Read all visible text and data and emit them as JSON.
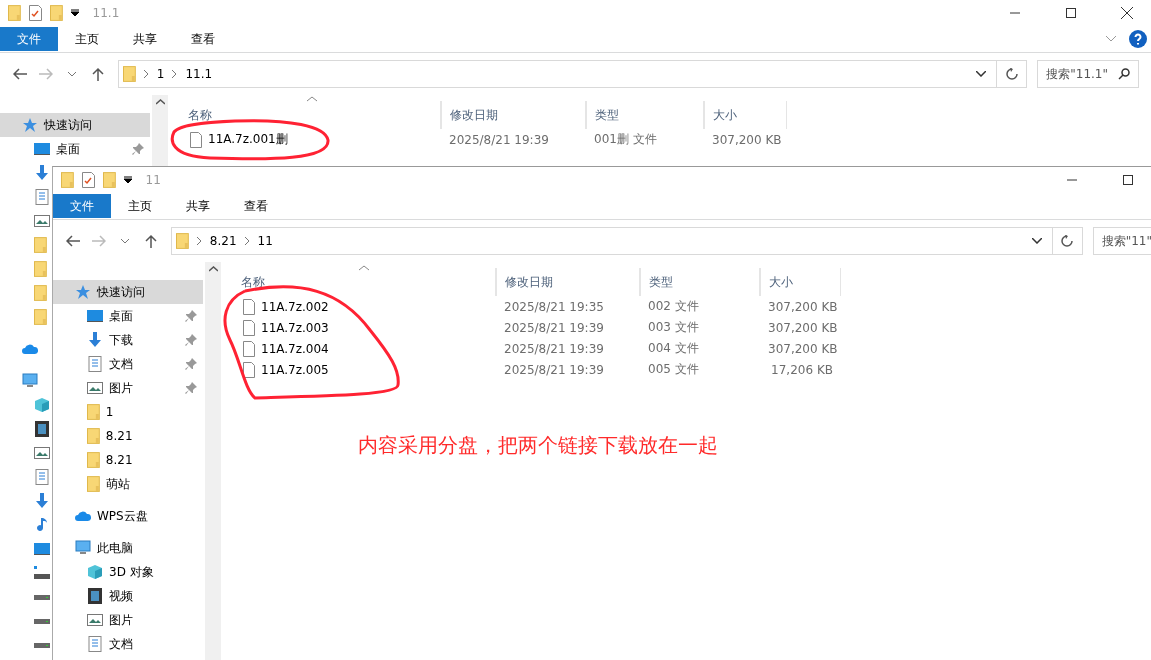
{
  "windows": [
    {
      "title": "11.1",
      "controls": [
        {
          "kind": "minimize"
        },
        {
          "kind": "maximize"
        },
        {
          "kind": "close"
        }
      ],
      "help": true,
      "ribbon_tabs": [
        {
          "label": "文件",
          "selected": true
        },
        {
          "label": "主页",
          "selected": false
        },
        {
          "label": "共享",
          "selected": false
        },
        {
          "label": "查看",
          "selected": false
        }
      ],
      "path": [
        "1",
        "11.1"
      ],
      "search": {
        "placeholder": "搜索\"11.1\""
      },
      "sidebar": [
        {
          "kind": "star",
          "label": "快速访问",
          "selected": true,
          "children": [
            {
              "kind": "desktop",
              "label": "桌面",
              "pinned": true
            },
            {
              "kind": "download"
            },
            {
              "kind": "doc"
            },
            {
              "kind": "picture"
            },
            {
              "kind": "folder"
            },
            {
              "kind": "folder"
            },
            {
              "kind": "folder"
            },
            {
              "kind": "folder"
            }
          ]
        },
        {
          "kind": "cloud"
        },
        {
          "kind": "pc",
          "children": [
            {
              "kind": "cube"
            },
            {
              "kind": "video"
            },
            {
              "kind": "picture"
            },
            {
              "kind": "doc"
            },
            {
              "kind": "download"
            },
            {
              "kind": "music"
            },
            {
              "kind": "desktop"
            },
            {
              "kind": "netdrive"
            },
            {
              "kind": "drive"
            },
            {
              "kind": "drive"
            },
            {
              "kind": "drive"
            }
          ]
        }
      ],
      "columns": [
        "名称",
        "修改日期",
        "类型",
        "大小"
      ],
      "files": [
        {
          "name": "11A.7z.001删",
          "date": "2025/8/21 19:39",
          "type": "001删 文件",
          "size": "307,200 KB"
        }
      ]
    },
    {
      "title": "11",
      "controls": [
        {
          "kind": "minimize"
        },
        {
          "kind": "maximize"
        }
      ],
      "help": false,
      "ribbon_tabs": [
        {
          "label": "文件",
          "selected": true
        },
        {
          "label": "主页",
          "selected": false
        },
        {
          "label": "共享",
          "selected": false
        },
        {
          "label": "查看",
          "selected": false
        }
      ],
      "path": [
        "8.21",
        "11"
      ],
      "search": {
        "placeholder": "搜索\"11\""
      },
      "sidebar": [
        {
          "kind": "star",
          "label": "快速访问",
          "selected": true,
          "children": [
            {
              "kind": "desktop",
              "label": "桌面",
              "pinned": true
            },
            {
              "kind": "download",
              "label": "下载",
              "pinned": true
            },
            {
              "kind": "doc",
              "label": "文档",
              "pinned": true
            },
            {
              "kind": "picture",
              "label": "图片",
              "pinned": true
            },
            {
              "kind": "folder",
              "label": "1",
              "pinned": false
            },
            {
              "kind": "folder",
              "label": "8.21",
              "pinned": false
            },
            {
              "kind": "folder",
              "label": "8.21",
              "pinned": false
            },
            {
              "kind": "folder",
              "label": "萌站",
              "pinned": false
            }
          ]
        },
        {
          "kind": "cloud",
          "label": "WPS云盘"
        },
        {
          "kind": "pc",
          "label": "此电脑",
          "children": [
            {
              "kind": "cube",
              "label": "3D 对象"
            },
            {
              "kind": "video",
              "label": "视频"
            },
            {
              "kind": "picture",
              "label": "图片"
            },
            {
              "kind": "doc",
              "label": "文档"
            }
          ]
        }
      ],
      "columns": [
        "名称",
        "修改日期",
        "类型",
        "大小"
      ],
      "files": [
        {
          "name": "11A.7z.002",
          "date": "2025/8/21 19:35",
          "type": "002 文件",
          "size": "307,200 KB"
        },
        {
          "name": "11A.7z.003",
          "date": "2025/8/21 19:39",
          "type": "003 文件",
          "size": "307,200 KB"
        },
        {
          "name": "11A.7z.004",
          "date": "2025/8/21 19:39",
          "type": "004 文件",
          "size": "307,200 KB"
        },
        {
          "name": "11A.7z.005",
          "date": "2025/8/21 19:39",
          "type": "005 文件",
          "size": "17,206 KB"
        }
      ]
    }
  ],
  "annotation": {
    "text": "内容采用分盘，把两个链接下载放在一起"
  }
}
